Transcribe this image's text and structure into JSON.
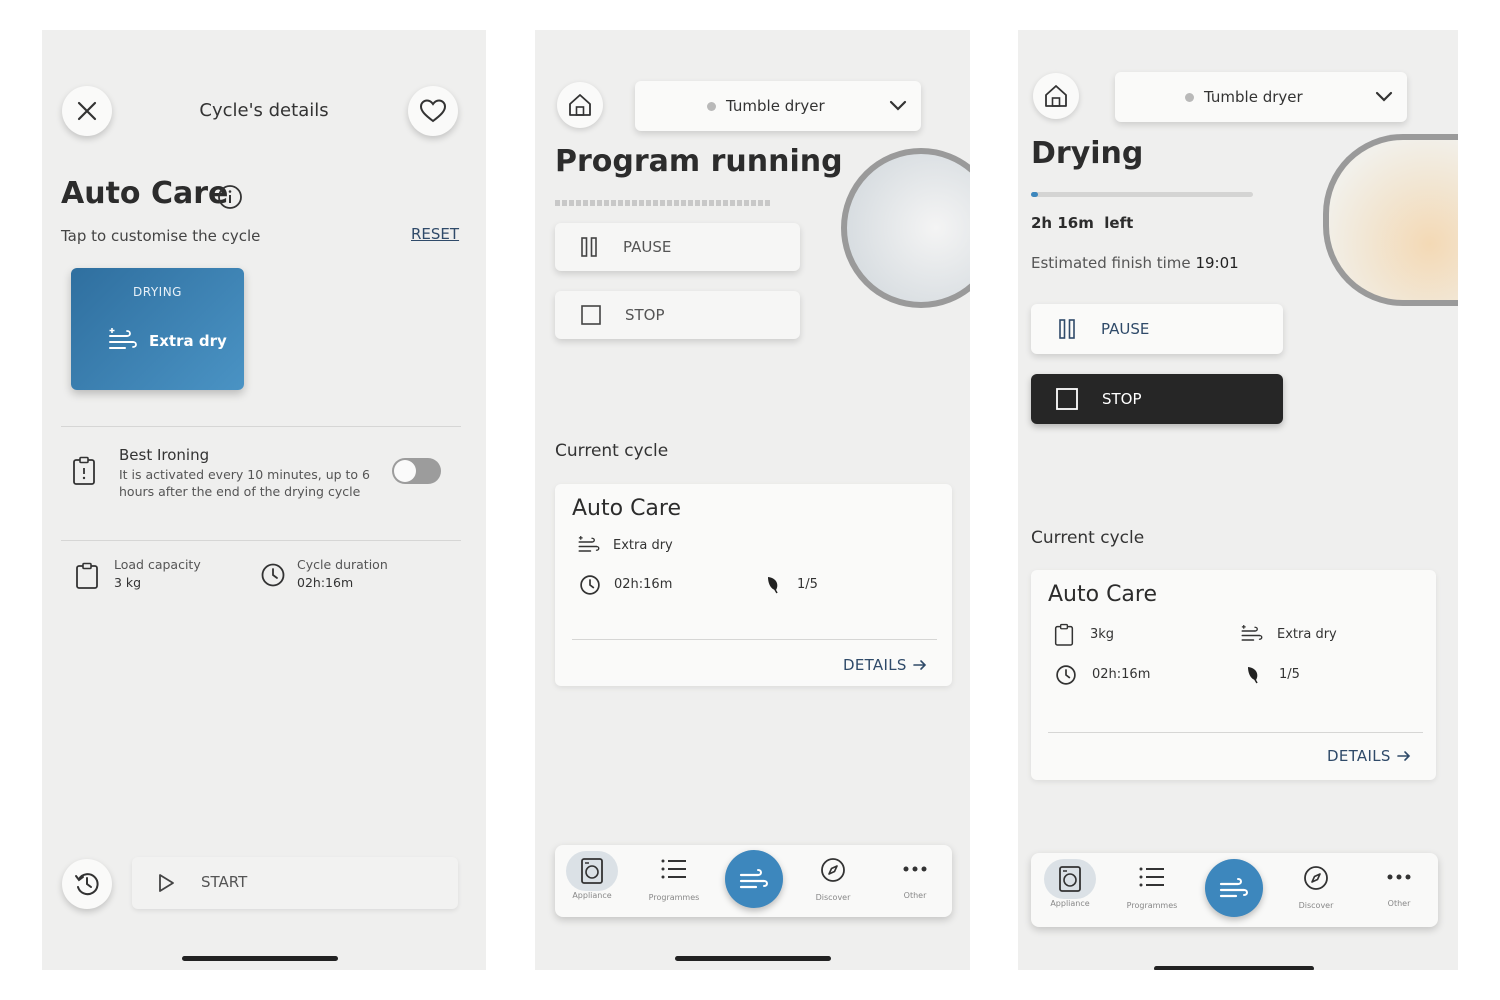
{
  "screen1": {
    "header_title": "Cycle's details",
    "program_title": "Auto Care",
    "subtitle": "Tap to customise the cycle",
    "reset_label": "RESET",
    "drying_tile": {
      "label": "DRYING",
      "value": "Extra dry"
    },
    "best_ironing": {
      "title": "Best Ironing",
      "description": "It is activated every 10 minutes, up to 6 hours after the end of the drying cycle",
      "enabled": false
    },
    "load_capacity": {
      "label": "Load capacity",
      "value": "3 kg"
    },
    "cycle_duration": {
      "label": "Cycle duration",
      "value": "02h:16m"
    },
    "start_label": "START"
  },
  "screen2": {
    "appliance": "Tumble dryer",
    "title": "Program running",
    "pause_label": "PAUSE",
    "stop_label": "STOP",
    "current_cycle_label": "Current cycle",
    "cycle": {
      "name": "Auto Care",
      "dryness": "Extra dry",
      "duration": "02h:16m",
      "eco_rating": "1/5"
    },
    "details_label": "DETAILS"
  },
  "screen3": {
    "appliance": "Tumble dryer",
    "title": "Drying",
    "progress": 0.03,
    "time_left": "2h 16m  left",
    "finish_label": "Estimated finish time",
    "finish_time": "19:01",
    "pause_label": "PAUSE",
    "stop_label": "STOP",
    "current_cycle_label": "Current cycle",
    "cycle": {
      "name": "Auto Care",
      "load": "3kg",
      "dryness": "Extra dry",
      "duration": "02h:16m",
      "eco_rating": "1/5"
    },
    "details_label": "DETAILS"
  },
  "navbar": {
    "items": [
      "Appliance",
      "Programmes",
      "Discover",
      "Other"
    ]
  },
  "colors": {
    "accent_blue": "#3d87bd",
    "tile_blue": "#3a7fb1",
    "stop_dark": "#262626",
    "background": "#efefee"
  }
}
